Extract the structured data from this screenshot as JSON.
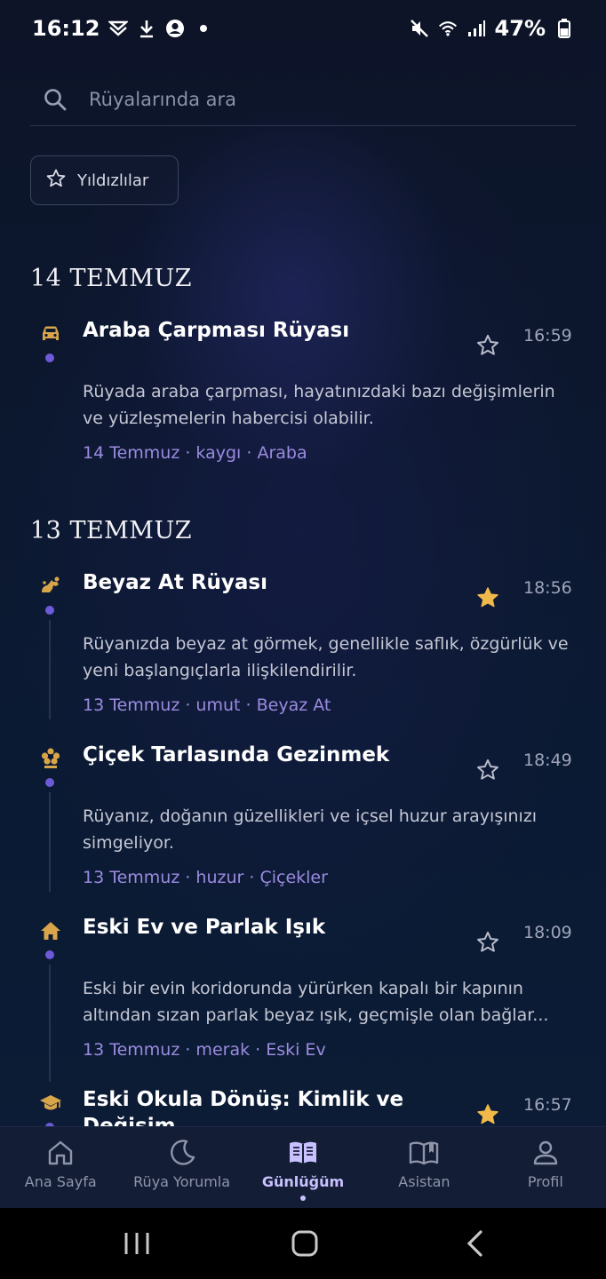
{
  "status_bar": {
    "time": "16:12",
    "battery": "47%"
  },
  "search": {
    "placeholder": "Rüyalarında ara"
  },
  "filter": {
    "starred_label": "Yıldızlılar"
  },
  "sections": [
    {
      "date": "14 TEMMUZ",
      "entries": [
        {
          "icon": "car-icon",
          "title": "Araba Çarpması Rüyası",
          "time": "16:59",
          "starred": false,
          "description": "Rüyada araba çarpması, hayatınızdaki bazı değişimlerin ve yüzleşmelerin habercisi olabilir.",
          "meta": "14 Temmuz · kaygı · Araba"
        }
      ]
    },
    {
      "date": "13 TEMMUZ",
      "entries": [
        {
          "icon": "horse-icon",
          "title": "Beyaz At Rüyası",
          "time": "18:56",
          "starred": true,
          "description": "Rüyanızda beyaz at görmek, genellikle saflık, özgürlük ve yeni başlangıçlarla ilişkilendirilir.",
          "meta": "13 Temmuz · umut · Beyaz At"
        },
        {
          "icon": "flower-icon",
          "title": "Çiçek Tarlasında Gezinmek",
          "time": "18:49",
          "starred": false,
          "description": "Rüyanız, doğanın güzellikleri ve içsel huzur arayışınızı simgeliyor.",
          "meta": "13 Temmuz · huzur · Çiçekler"
        },
        {
          "icon": "home-icon",
          "title": "Eski Ev ve Parlak Işık",
          "time": "18:09",
          "starred": false,
          "description": "Eski bir evin koridorunda yürürken kapalı bir kapının altından sızan parlak beyaz ışık, geçmişle olan bağlar...",
          "meta": "13 Temmuz · merak · Eski Ev"
        },
        {
          "icon": "graduation-cap-icon",
          "title": "Eski Okula Dönüş: Kimlik ve Değişim",
          "time": "16:57",
          "starred": true
        }
      ]
    }
  ],
  "bottom_nav": [
    {
      "label": "Ana Sayfa",
      "icon": "home-icon",
      "active": false
    },
    {
      "label": "Rüya Yorumla",
      "icon": "moon-icon",
      "active": false
    },
    {
      "label": "Günlüğüm",
      "icon": "book-icon",
      "active": true
    },
    {
      "label": "Asistan",
      "icon": "open-book-icon",
      "active": false
    },
    {
      "label": "Profil",
      "icon": "user-icon",
      "active": false
    }
  ],
  "colors": {
    "accent": "#6d5ad8",
    "star_active": "#f0b94a",
    "icon_gold": "#d9a54a",
    "meta": "#9b8be0"
  }
}
